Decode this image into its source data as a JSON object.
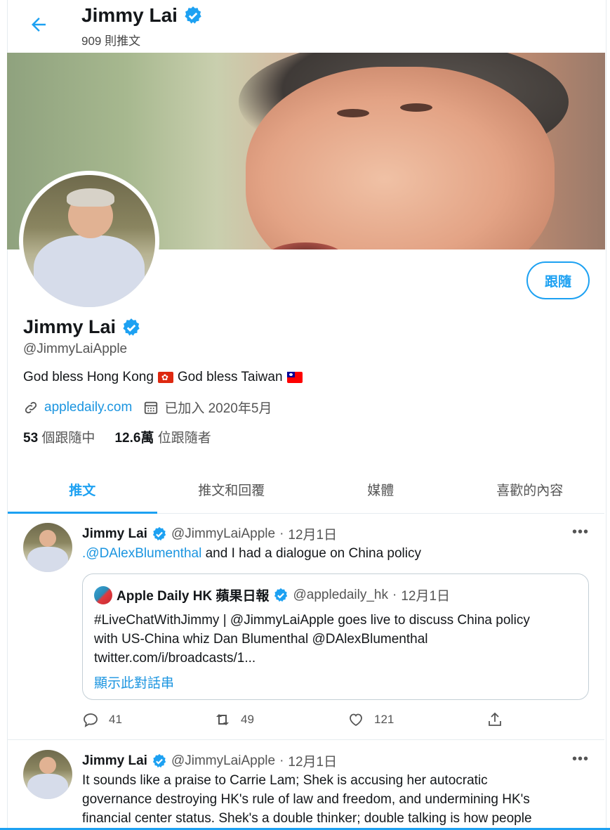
{
  "header": {
    "name": "Jimmy Lai",
    "tweet_count": "909 則推文"
  },
  "profile": {
    "follow_label": "跟隨",
    "name": "Jimmy Lai",
    "handle": "@JimmyLaiApple",
    "bio_part1": "God bless Hong Kong",
    "bio_part2": "God bless Taiwan",
    "website": "appledaily.com",
    "joined": "已加入 2020年5月",
    "following_count": "53",
    "following_label": "個跟隨中",
    "followers_count": "12.6萬",
    "followers_label": "位跟隨者"
  },
  "tabs": [
    "推文",
    "推文和回覆",
    "媒體",
    "喜歡的內容"
  ],
  "tweets": [
    {
      "name": "Jimmy Lai",
      "handle": "@JimmyLaiApple",
      "sep": "·",
      "date": "12月1日",
      "mention": ".@DAlexBlumenthal",
      "text": " and I had a dialogue on China policy",
      "quote": {
        "name": "Apple Daily HK 蘋果日報",
        "handle": "@appledaily_hk",
        "sep": "·",
        "date": "12月1日",
        "line1": "#LiveChatWithJimmy | @JimmyLaiApple goes live to discuss China policy",
        "line2": "with US-China whiz Dan Blumenthal @DAlexBlumenthal",
        "line3": "twitter.com/i/broadcasts/1...",
        "show_thread": "顯示此對話串"
      },
      "replies": "41",
      "retweets": "49",
      "likes": "121"
    },
    {
      "name": "Jimmy Lai",
      "handle": "@JimmyLaiApple",
      "sep": "·",
      "date": "12月1日",
      "line1": "It sounds like a praise to Carrie Lam; Shek is accusing her autocratic",
      "line2": "governance destroying HK's rule of law and freedom, and undermining HK's",
      "line3": "financial center status. Shek's a double thinker; double talking is how people"
    }
  ],
  "colors": {
    "accent": "#1da1f2",
    "link": "#1b95e0",
    "text": "#14171a",
    "muted": "#555555"
  }
}
